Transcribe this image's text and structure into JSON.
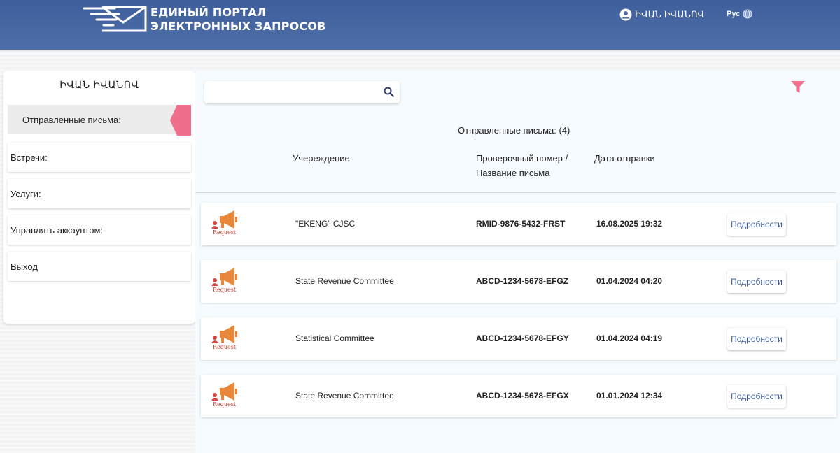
{
  "header": {
    "logo_line1": "ЕДИНЫЙ ПОРТАЛ",
    "logo_line2": "ЭЛЕКТРОННЫХ ЗАПРОСОВ",
    "user_name": "ԻՎԱՆ ԻՎԱՆՈՎ",
    "language": "Рус"
  },
  "sidebar": {
    "user_name": "ԻՎԱՆ ԻՎԱՆՈՎ",
    "items": [
      {
        "label": "Отправленные письма:"
      },
      {
        "label": "Встречи:"
      },
      {
        "label": "Услуги:"
      },
      {
        "label": "Управлять аккаунтом:"
      },
      {
        "label": "Выход"
      }
    ]
  },
  "main": {
    "search": {
      "value": "",
      "placeholder": ""
    },
    "count_label": "Отправленные письма: (4)",
    "columns": {
      "institution": "Учереждение",
      "number_line1": "Проверочный номер /",
      "number_line2": "Название письма",
      "date": "Дата отправки"
    },
    "icon_label": "Request",
    "details_label": "Подробности",
    "rows": [
      {
        "institution": "\"EKENG\" CJSC",
        "number": "RMID-9876-5432-FRST",
        "date": "16.08.2025 19:32"
      },
      {
        "institution": "State Revenue Committee",
        "number": "ABCD-1234-5678-EFGZ",
        "date": "01.04.2024 04:20"
      },
      {
        "institution": "Statistical Committee",
        "number": "ABCD-1234-5678-EFGY",
        "date": "01.04.2024 04:19"
      },
      {
        "institution": "State Revenue Committee",
        "number": "ABCD-1234-5678-EFGX",
        "date": "01.01.2024 12:34"
      }
    ]
  },
  "colors": {
    "header_bg": "#4a68a3",
    "accent_pink": "#ee6e8c",
    "megaphone_orange": "#e8873a",
    "link_blue": "#3d5c9b"
  },
  "icons": {
    "logo": "envelope-logo-icon",
    "user": "user-circle-icon",
    "language": "globe-icon",
    "search": "search-icon",
    "filter": "filter-icon",
    "request": "megaphone-icon"
  }
}
